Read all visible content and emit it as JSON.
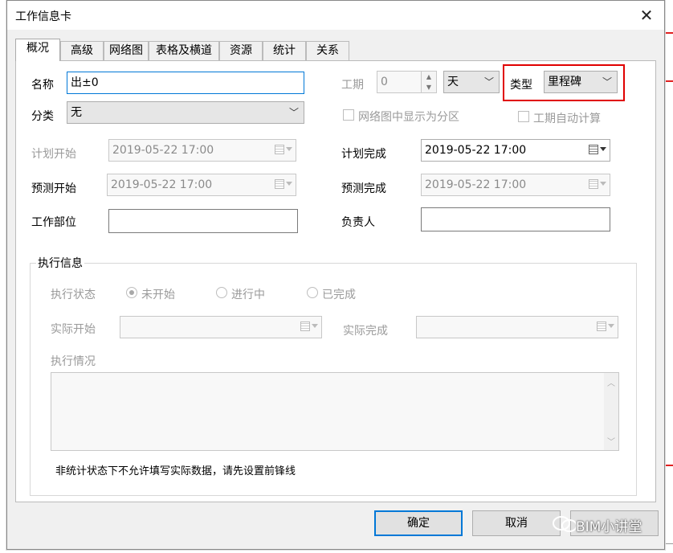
{
  "dialog": {
    "title": "工作信息卡",
    "close_glyph": "✕"
  },
  "tabs": [
    "概况",
    "高级",
    "网络图",
    "表格及横道",
    "资源",
    "统计",
    "关系"
  ],
  "fields": {
    "name_label": "名称",
    "name_value": "出±0",
    "duration_label": "工期",
    "duration_value": "0",
    "duration_unit": "天",
    "type_label": "类型",
    "type_value": "里程碑",
    "category_label": "分类",
    "category_value": "无",
    "show_as_partition": "网络图中显示为分区",
    "auto_duration": "工期自动计算",
    "plan_start_label": "计划开始",
    "plan_start_value": "2019-05-22 17:00",
    "plan_finish_label": "计划完成",
    "plan_finish_value": "2019-05-22 17:00",
    "forecast_start_label": "预测开始",
    "forecast_start_value": "2019-05-22 17:00",
    "forecast_finish_label": "预测完成",
    "forecast_finish_value": "2019-05-22 17:00",
    "work_part_label": "工作部位",
    "work_part_value": "",
    "owner_label": "负责人",
    "owner_value": ""
  },
  "execution": {
    "group_title": "执行信息",
    "status_label": "执行状态",
    "status_options": [
      "未开始",
      "进行中",
      "已完成"
    ],
    "selected_status": "未开始",
    "actual_start_label": "实际开始",
    "actual_finish_label": "实际完成",
    "situation_label": "执行情况",
    "note": "非统计状态下不允许填写实际数据，请先设置前锋线"
  },
  "buttons": {
    "ok": "确定",
    "cancel": "取消"
  },
  "watermark": "BIM小讲堂",
  "colors": {
    "highlight": "#e00000",
    "focus": "#0078d7"
  }
}
